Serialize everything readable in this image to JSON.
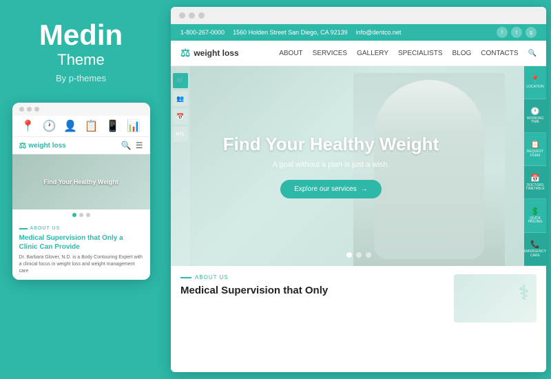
{
  "leftPanel": {
    "brandTitle": "Medin",
    "brandSubtitle": "Theme",
    "brandAuthor": "By p-themes"
  },
  "mobileMockup": {
    "topBarDots": [
      "dot1",
      "dot2",
      "dot3"
    ],
    "icons": [
      "📍",
      "🕐",
      "👤",
      "📋",
      "📱",
      "📊"
    ],
    "logo": "weight loss",
    "heroText": "Find Your Healthy Weight",
    "dots": [
      true,
      false,
      false
    ],
    "aboutLabel": "About us",
    "aboutTitle": "Medical Supervision that Only a ",
    "aboutTitleLink": "Clinic Can Provide",
    "aboutDesc": "Dr. Barbara Glover, N.D. is a Body Contouring Expert with a clinical focus in weight loss and weight management care"
  },
  "browser": {
    "dots": [
      "dot1",
      "dot2",
      "dot3"
    ],
    "topBar": {
      "phone": "1-800-267-0000",
      "address": "1560 Holden Street San Diego, CA 92139",
      "email": "info@dentco.net",
      "socials": [
        "f",
        "t",
        "g"
      ]
    },
    "header": {
      "logo": "weight loss",
      "nav": [
        "ABOUT",
        "SERVICES",
        "GALLERY",
        "SPECIALISTS",
        "BLOG",
        "CONTACTS"
      ]
    },
    "hero": {
      "title": "Find Your Healthy Weight",
      "subtitle": "A goal without a plan is just a wish.",
      "btnLabel": "Explore our services",
      "dots": [
        true,
        false,
        false
      ],
      "leftToolbar": [
        "🛒",
        "👥",
        "📅",
        "RTL"
      ],
      "rightSidebar": [
        {
          "icon": "📍",
          "label": "LOCATION"
        },
        {
          "icon": "🕐",
          "label": "WORKING TIME"
        },
        {
          "icon": "📋",
          "label": "REQUEST FORM"
        },
        {
          "icon": "📅",
          "label": "DOCTORS TIMETABLE"
        },
        {
          "icon": "💲",
          "label": "QUICK PRICING"
        },
        {
          "icon": "📞",
          "label": "EMERGENCY CARE"
        }
      ]
    },
    "belowHero": {
      "aboutLabel": "About us",
      "title": "Medical Supervision that Only"
    }
  }
}
